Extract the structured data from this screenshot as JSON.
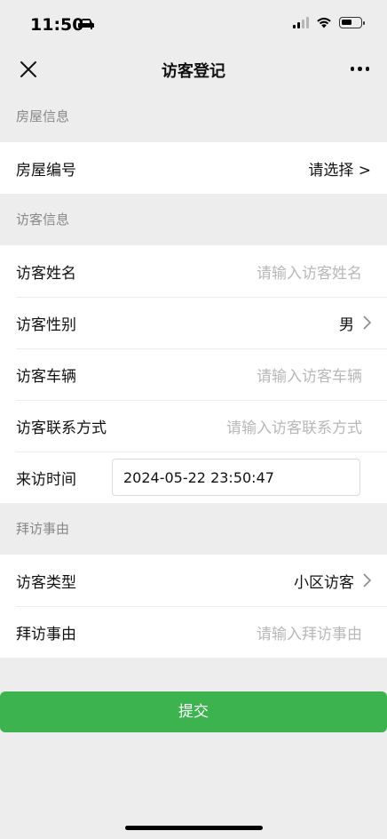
{
  "status_bar": {
    "time": "11:50"
  },
  "nav": {
    "title": "访客登记"
  },
  "sections": {
    "house": {
      "header": "房屋信息",
      "house_number": {
        "label": "房屋编号",
        "value": "请选择 >"
      }
    },
    "visitor": {
      "header": "访客信息",
      "name": {
        "label": "访客姓名",
        "placeholder": "请输入访客姓名"
      },
      "gender": {
        "label": "访客性别",
        "value": "男"
      },
      "vehicle": {
        "label": "访客车辆",
        "placeholder": "请输入访客车辆"
      },
      "contact": {
        "label": "访客联系方式",
        "placeholder": "请输入访客联系方式"
      },
      "visit_time": {
        "label": "来访时间",
        "value": "2024-05-22 23:50:47"
      }
    },
    "reason": {
      "header": "拜访事由",
      "visitor_type": {
        "label": "访客类型",
        "value": "小区访客"
      },
      "visit_reason": {
        "label": "拜访事由",
        "placeholder": "请输入拜访事由"
      }
    }
  },
  "submit_label": "提交",
  "colors": {
    "accent": "#3cb34f",
    "background": "#ededed",
    "placeholder": "#b8b8b8"
  }
}
